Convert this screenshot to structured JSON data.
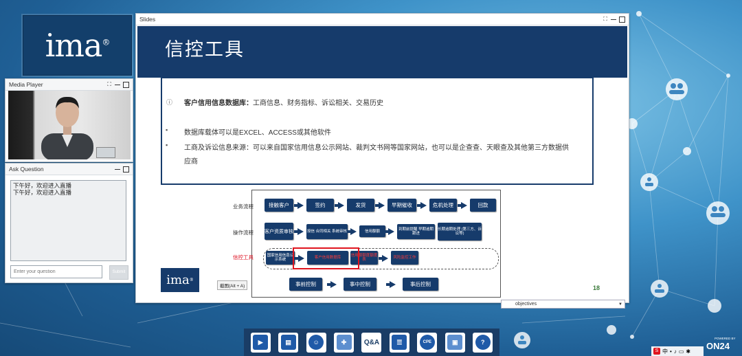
{
  "logo": {
    "text": "ima"
  },
  "media_player": {
    "title": "Media Player"
  },
  "ask_question": {
    "title": "Ask Question",
    "messages": "下午好，欢迎进入直播\n下午好，欢迎进入直播",
    "input_placeholder": "Enter your question",
    "submit_label": "Submit"
  },
  "slides": {
    "title": "Slides",
    "slide_title": "信控工具",
    "item1_lead": "客户信用信息数据库：",
    "item1_rest": "工商信息、财务指标、诉讼相关、交易历史",
    "item2": "数据库载体可以是EXCEL、ACCESS或其他软件",
    "item3_line1": "工商及诉讼信息来源：可以来自国家信用信息公示网站、裁判文书网等国家网站，也可以是企查查、天眼查及其他第三方数据供",
    "item3_line2": "应商",
    "diagram": {
      "row_labels": [
        "业务流程",
        "操作流程",
        "信控工具"
      ],
      "business": [
        "接触客户",
        "签约",
        "发货",
        "早期催收",
        "危机处理",
        "回款"
      ],
      "operations": [
        "客户资质审核",
        "授信 合同相关 系统审核",
        "信用额额",
        "到期前提醒 早期逾期跟进",
        "长期逾期处理 (第三方、诉讼等)"
      ],
      "tools": [
        "国家信用信息公示系统",
        "客户信用数据库",
        "信用额额度额度表",
        "风险监控工作"
      ],
      "controls": [
        "事前控制",
        "事中控制",
        "事后控制"
      ]
    },
    "logo_text": "ima",
    "tooltip": "截图(Alt + A)",
    "page_number": "18"
  },
  "objectives": {
    "label": "objectives"
  },
  "toolbar": {
    "qa_label": "Q&A",
    "cpe_label": "CPE"
  },
  "tray": {
    "lang": "中"
  },
  "brand": {
    "powered_by": "POWERED BY",
    "name": "ON24"
  }
}
